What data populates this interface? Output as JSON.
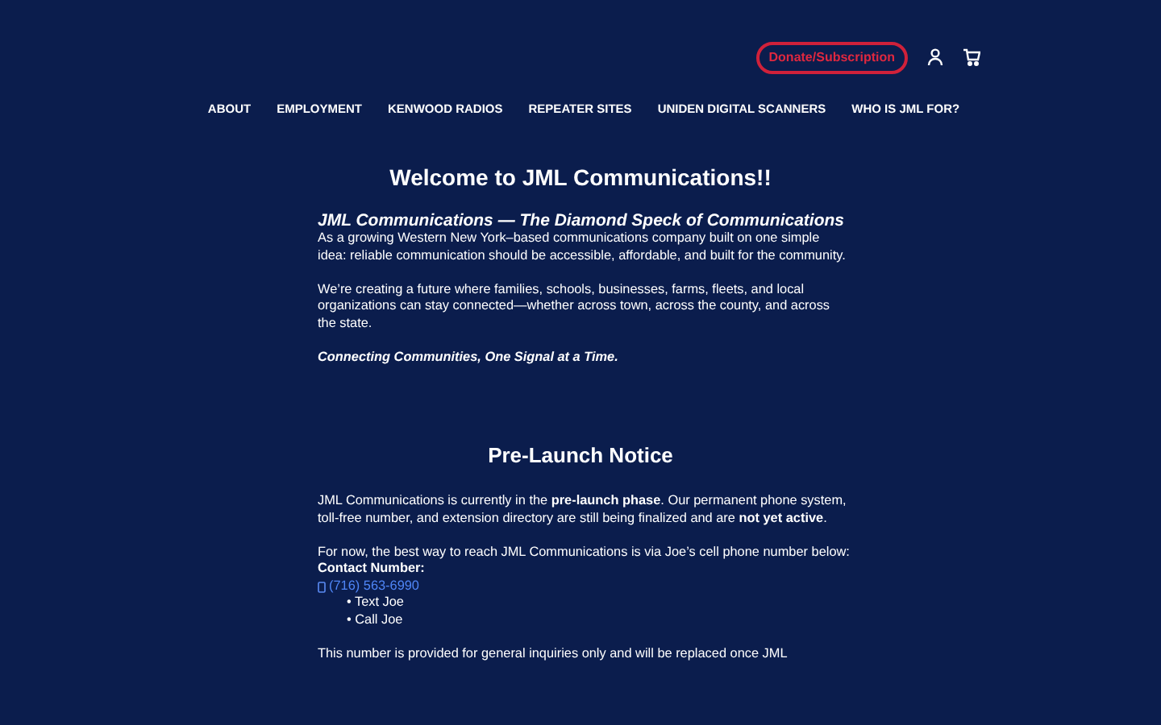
{
  "header": {
    "donate_button": "Donate/Subscription"
  },
  "nav": [
    "ABOUT",
    "EMPLOYMENT",
    "KENWOOD RADIOS",
    "REPEATER SITES",
    "UNIDEN DIGITAL SCANNERS",
    "WHO IS JML FOR?"
  ],
  "welcome": {
    "title": "Welcome to JML Communications!!",
    "subtitle": "JML Communications — The Diamond Speck of Communications",
    "paragraphs": [
      "As a growing Western New York–based communications company built on one simple idea: reliable communication should be accessible, affordable, and built for the community.",
      "We’re creating a future where families, schools, businesses, farms, fleets, and local organizations can stay connected—whether across town, across the county, and across the state."
    ],
    "tagline": "Connecting Communities, One Signal at a Time."
  },
  "notice": {
    "title": "Pre-Launch Notice",
    "paragraphs": [
      "JML Communications is currently in the **pre-launch phase**. Our permanent phone system, toll-free number, and extension directory are still being finalized and are **not yet active**.",
      "For now, the best way to reach JML Communications is via Joe’s cell phone number below:"
    ],
    "contact_label": "Contact Number:",
    "phone": "(716) 563-6990",
    "options": [
      "• Text Joe",
      "• Call Joe"
    ],
    "footer": "This number is provided for general inquiries only and will be replaced once JML"
  }
}
